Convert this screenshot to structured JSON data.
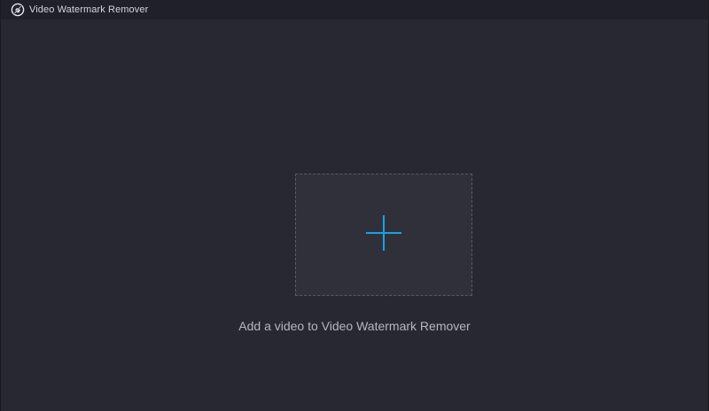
{
  "window": {
    "title": "Video Watermark Remover",
    "icon": "watermark-remover-logo-icon"
  },
  "dropzone": {
    "icon": "plus-icon",
    "hint": "Add a video to Video Watermark Remover"
  },
  "colors": {
    "background": "#282832",
    "titlebar": "#20202a",
    "dropzone_fill": "#30303b",
    "dropzone_border": "#5a5a68",
    "accent": "#1ba1e2",
    "text": "#b6b6c0"
  }
}
